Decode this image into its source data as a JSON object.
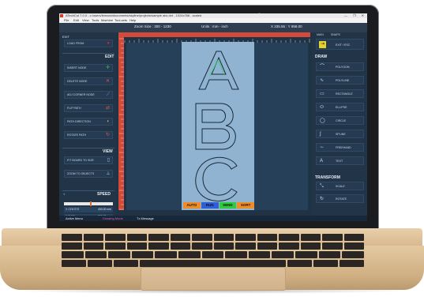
{
  "window": {
    "title": "ATechCut 7.0.0 - c:/users/lemoan/documents/skyline/projects/sample abc.dxf - 1024x768 - scaled",
    "controls": "— ❐ ✕"
  },
  "menu": [
    "File",
    "Edit",
    "View",
    "Tools",
    "Machine",
    "Tool-sets",
    "Help"
  ],
  "topbar": {
    "zoom": "Zoom Size : 300 - 1230",
    "units": "Units : mm - inch",
    "coords": "X 335.55 : Y 958.00"
  },
  "left_panel": {
    "section_label": "EXIT",
    "load_button": "LOAD FROM",
    "edit_header": "EDIT",
    "edit_items": [
      {
        "label": "INSERT NODE",
        "icon": "insert-node-icon",
        "glyph": "✛",
        "color": "#38d05a"
      },
      {
        "label": "DELETE NODE",
        "icon": "delete-node-icon",
        "glyph": "✕",
        "color": "#e8554a"
      },
      {
        "label": "ADJ CORNER NODE",
        "icon": "corner-node-icon",
        "glyph": "⟋",
        "color": "#7fb0e0"
      },
      {
        "label": "FLIP PATH",
        "icon": "flip-path-icon",
        "glyph": "⇄",
        "color": "#e8554a"
      },
      {
        "label": "PATH DIRECTION",
        "icon": "path-direction-icon",
        "glyph": "◐",
        "color": "#e0a030"
      },
      {
        "label": "ROTATE PATH",
        "icon": "rotate-path-icon",
        "glyph": "↻",
        "color": "#e8554a"
      }
    ],
    "view_header": "VIEW",
    "view_items": [
      {
        "label": "FIT BOARD TO SIZE",
        "icon": "fit-board-icon",
        "glyph": "▯",
        "color": "#9fc0e0"
      },
      {
        "label": "ZOOM TO OBJECTS",
        "icon": "zoom-objects-icon",
        "glyph": "⟂",
        "color": "#9fc0e0"
      }
    ],
    "speed_header": "SPEED",
    "speed_level": 0.55,
    "info": [
      {
        "key": "X CENTER",
        "value": "400.00 mm"
      },
      {
        "key": "Y TYPE",
        "value": "300.00 mm"
      }
    ]
  },
  "canvas": {
    "letters": [
      "A",
      "B",
      "C"
    ],
    "status": [
      {
        "label": "AUTO",
        "color": "#f08c28"
      },
      {
        "label": "RUN",
        "color": "#2f5fd8"
      },
      {
        "label": "SEND",
        "color": "#2ecb3f"
      },
      {
        "label": "SORT",
        "color": "#f08c28"
      }
    ]
  },
  "right_panel": {
    "tabs": [
      "MAIN",
      "SNAPS"
    ],
    "exit_label": "EXIT / ESC",
    "draw_header": "DRAW",
    "draw_items": [
      {
        "label": "POLYGON",
        "icon": "polygon-icon",
        "glyph": "⌒"
      },
      {
        "label": "POLYLINE",
        "icon": "polyline-icon",
        "glyph": "∿"
      },
      {
        "label": "RECTANGLE",
        "icon": "rectangle-icon",
        "glyph": "▭"
      },
      {
        "label": "ELLIPSE",
        "icon": "ellipse-icon",
        "glyph": "⬭"
      },
      {
        "label": "CIRCLE",
        "icon": "circle-icon",
        "glyph": "◯"
      },
      {
        "label": "SPLINE",
        "icon": "spline-icon",
        "glyph": "∫"
      },
      {
        "label": "FREEHAND",
        "icon": "freehand-icon",
        "glyph": "∼"
      },
      {
        "label": "TEXT",
        "icon": "text-icon",
        "glyph": "A"
      }
    ],
    "transform_header": "TRANSFORM",
    "transform_items": [
      {
        "label": "SCALE",
        "icon": "scale-icon",
        "glyph": "⤡"
      },
      {
        "label": "ROTATE",
        "icon": "rotate-icon",
        "glyph": "↻"
      }
    ]
  },
  "bottom_bar": {
    "item1": "Active Menu",
    "item2": "Drawing Mode",
    "item3": "Tx Message"
  }
}
